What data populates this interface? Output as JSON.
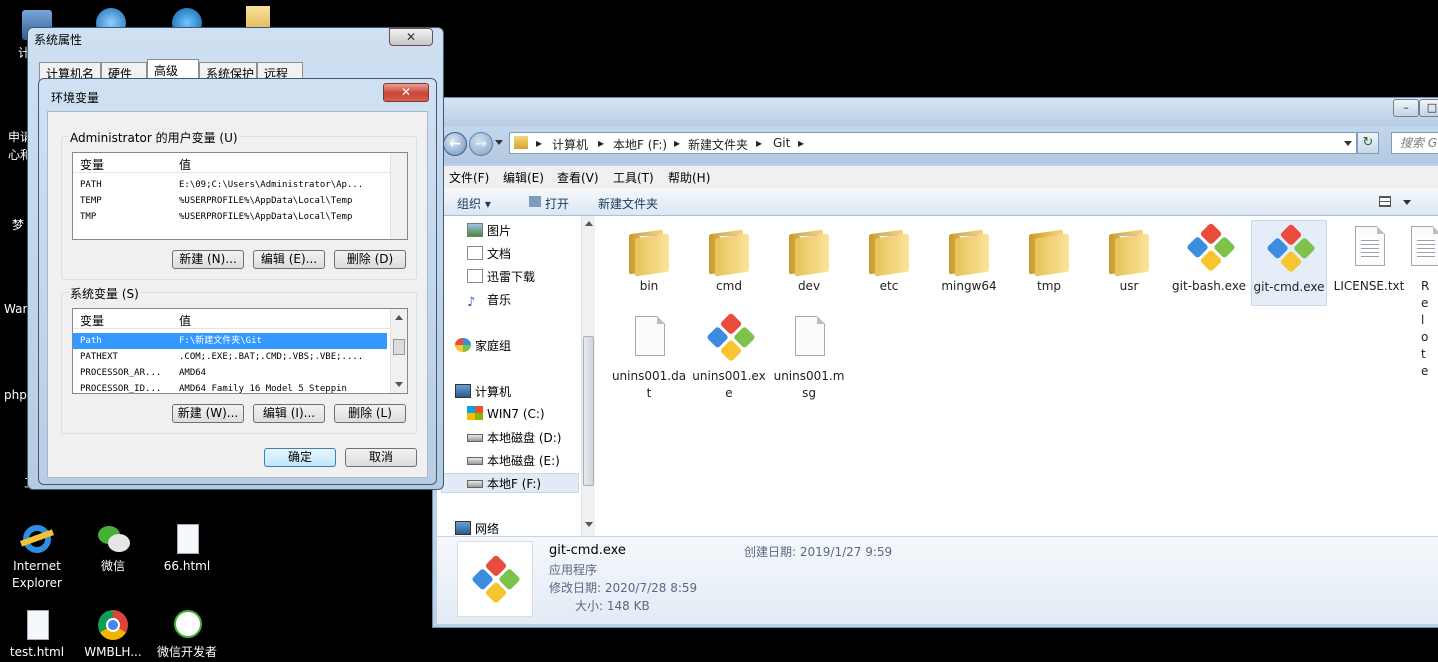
{
  "desktop": {
    "icons": [
      {
        "label": "Internet Explorer",
        "icon": "ie-icon"
      },
      {
        "label": "微信",
        "icon": "wechat-icon"
      },
      {
        "label": "66.html",
        "icon": "html-file-icon"
      },
      {
        "label": "test.html",
        "icon": "html-file-icon"
      },
      {
        "label": "WMBLH...",
        "icon": "chrome-icon"
      },
      {
        "label": "微信开发者",
        "icon": "wechat-devtools-icon"
      }
    ],
    "partial_left_labels": [
      "计",
      "申请",
      "心和",
      "梦",
      "War",
      "php",
      "工作"
    ]
  },
  "explorer": {
    "window_buttons": [
      "–",
      "□"
    ],
    "back": "←",
    "forward": "→",
    "breadcrumb": [
      "计算机",
      "本地F (F:)",
      "新建文件夹",
      "Git"
    ],
    "refresh": "↻",
    "search_placeholder": "搜索 G",
    "menu": [
      "文件(F)",
      "编辑(E)",
      "查看(V)",
      "工具(T)",
      "帮助(H)"
    ],
    "toolbar": {
      "organize": "组织 ▾",
      "open": "打开",
      "new_folder": "新建文件夹"
    },
    "nav": [
      {
        "label": "图片",
        "icon": "pictures-icon"
      },
      {
        "label": "文档",
        "icon": "documents-icon"
      },
      {
        "label": "迅雷下载",
        "icon": "download-icon"
      },
      {
        "label": "音乐",
        "icon": "music-icon"
      },
      {
        "label": "家庭组",
        "icon": "homegroup-icon"
      },
      {
        "label": "计算机",
        "icon": "computer-icon"
      },
      {
        "label": "WIN7 (C:)",
        "icon": "windows-drive-icon"
      },
      {
        "label": "本地磁盘 (D:)",
        "icon": "drive-icon"
      },
      {
        "label": "本地磁盘 (E:)",
        "icon": "drive-icon"
      },
      {
        "label": "本地F (F:)",
        "icon": "drive-icon"
      },
      {
        "label": "网络",
        "icon": "network-icon"
      }
    ],
    "files": [
      {
        "name": "bin",
        "type": "folder"
      },
      {
        "name": "cmd",
        "type": "folder"
      },
      {
        "name": "dev",
        "type": "folder"
      },
      {
        "name": "etc",
        "type": "folder"
      },
      {
        "name": "mingw64",
        "type": "folder"
      },
      {
        "name": "tmp",
        "type": "folder"
      },
      {
        "name": "usr",
        "type": "folder"
      },
      {
        "name": "git-bash.exe",
        "type": "git"
      },
      {
        "name": "git-cmd.exe",
        "type": "git"
      },
      {
        "name": "LICENSE.txt",
        "type": "doc"
      },
      {
        "name": "Rel ote",
        "type": "doc"
      },
      {
        "name": "unins001.dat",
        "type": "doc"
      },
      {
        "name": "unins001.exe",
        "type": "git"
      },
      {
        "name": "unins001.msg",
        "type": "doc"
      }
    ],
    "details": {
      "name": "git-cmd.exe",
      "type": "应用程序",
      "modified": "修改日期: 2020/7/28 8:59",
      "size": "大小: 148 KB",
      "created": "创建日期: 2019/1/27 9:59"
    }
  },
  "sysprops": {
    "title": "系统属性",
    "close": "✕",
    "tabs": [
      "计算机名",
      "硬件",
      "高级",
      "系统保护",
      "远程"
    ]
  },
  "envvars": {
    "title": "环境变量",
    "close": "✕",
    "user_group": "Administrator 的用户变量 (U)",
    "sys_group": "系统变量 (S)",
    "col_var": "变量",
    "col_val": "值",
    "user_vars": [
      {
        "name": "PATH",
        "value": "E:\\09;C:\\Users\\Administrator\\Ap..."
      },
      {
        "name": "TEMP",
        "value": "%USERPROFILE%\\AppData\\Local\\Temp"
      },
      {
        "name": "TMP",
        "value": "%USERPROFILE%\\AppData\\Local\\Temp"
      }
    ],
    "sys_vars": [
      {
        "name": "Path",
        "value": "F:\\新建文件夹\\Git"
      },
      {
        "name": "PATHEXT",
        "value": ".COM;.EXE;.BAT;.CMD;.VBS;.VBE;...."
      },
      {
        "name": "PROCESSOR_AR...",
        "value": "AMD64"
      },
      {
        "name": "PROCESSOR_ID...",
        "value": "AMD64 Family 16 Model 5 Steppin"
      }
    ],
    "buttons": {
      "user_new": "新建 (N)...",
      "user_edit": "编辑 (E)...",
      "user_delete": "删除 (D)",
      "sys_new": "新建 (W)...",
      "sys_edit": "编辑 (I)...",
      "sys_delete": "删除 (L)",
      "ok": "确定",
      "cancel": "取消"
    }
  }
}
